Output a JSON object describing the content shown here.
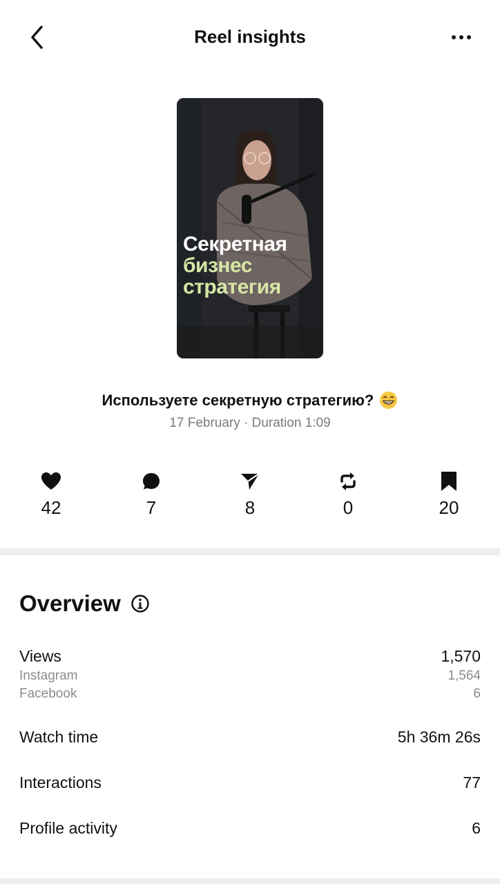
{
  "header": {
    "title": "Reel insights"
  },
  "icons": {
    "back": "chevron-left-icon",
    "more": "more-horizontal-icon",
    "likes": "heart-icon",
    "comments": "comment-icon",
    "shares": "send-icon",
    "reposts": "repost-icon",
    "saves": "bookmark-icon",
    "info": "info-icon"
  },
  "reel": {
    "thumbnail_text": [
      "Секретная",
      "бизнес",
      "стратегия"
    ],
    "caption": "Используете секретную стратегию?",
    "caption_emoji": "😁",
    "meta": "17 February · Duration 1:09"
  },
  "stats": [
    {
      "icon": "heart-icon",
      "value": "42"
    },
    {
      "icon": "comment-icon",
      "value": "7"
    },
    {
      "icon": "send-icon",
      "value": "8"
    },
    {
      "icon": "repost-icon",
      "value": "0"
    },
    {
      "icon": "bookmark-icon",
      "value": "20"
    }
  ],
  "overview": {
    "title": "Overview",
    "views": {
      "label": "Views",
      "value": "1,570"
    },
    "instagram": {
      "label": "Instagram",
      "value": "1,564"
    },
    "facebook": {
      "label": "Facebook",
      "value": "6"
    },
    "watch_time": {
      "label": "Watch time",
      "value": "5h 36m 26s"
    },
    "interactions": {
      "label": "Interactions",
      "value": "77"
    },
    "profile_activity": {
      "label": "Profile activity",
      "value": "6"
    }
  },
  "colors": {
    "thumbnail_accent_text": "#d7e6a6",
    "secondary_text": "#7a7a7a",
    "divider": "#eeeef0"
  }
}
